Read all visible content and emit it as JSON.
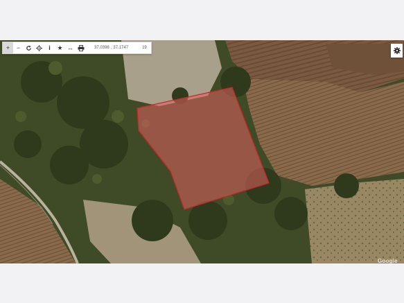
{
  "toolbar": {
    "buttons": [
      {
        "name": "zoom-in-button",
        "glyph": "+"
      },
      {
        "name": "zoom-out-button",
        "glyph": "−"
      },
      {
        "name": "refresh-button",
        "glyph": "refresh-icon"
      },
      {
        "name": "locate-button",
        "glyph": "locate-icon"
      },
      {
        "name": "info-button",
        "glyph": "i"
      },
      {
        "name": "favorite-button",
        "glyph": "★"
      },
      {
        "name": "measure-button",
        "glyph": "↔"
      },
      {
        "name": "print-button",
        "glyph": "print-icon"
      }
    ],
    "lat": "37.0396",
    "separator": ",",
    "lon": "37.1747",
    "zoom": "19"
  },
  "parcel": {
    "fill": "#e06060",
    "stroke": "#c42828"
  },
  "attribution": "Google",
  "colors": {
    "toolbar_bg": "#ffffff",
    "active_bg": "#d9d9d9"
  }
}
